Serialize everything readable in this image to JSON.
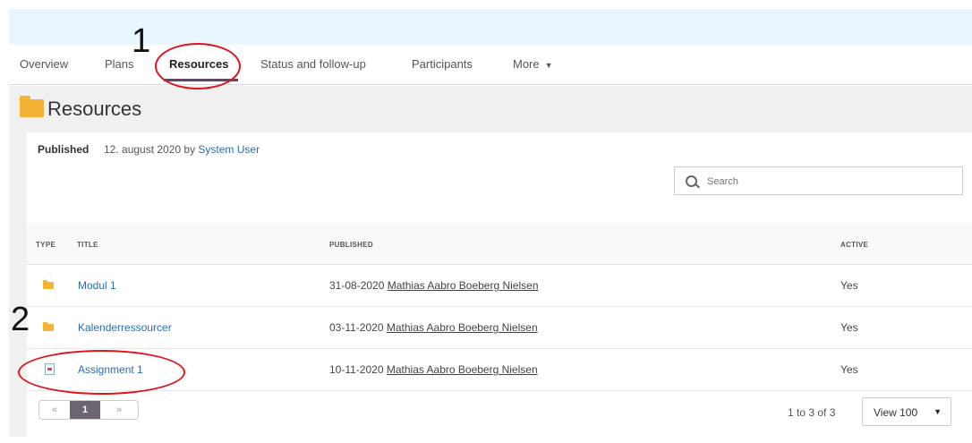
{
  "nav": {
    "tabs": [
      {
        "label": "Overview"
      },
      {
        "label": "Plans"
      },
      {
        "label": "Resources"
      },
      {
        "label": "Status and follow-up"
      },
      {
        "label": "Participants"
      },
      {
        "label": "More"
      }
    ]
  },
  "page": {
    "title": "Resources",
    "published_label": "Published",
    "published_date_text": "12. august 2020 by ",
    "published_by": "System User"
  },
  "search": {
    "placeholder": "Search",
    "value": ""
  },
  "table": {
    "headers": {
      "type": "TYPE",
      "title": "TITLE",
      "published": "PUBLISHED",
      "active": "ACTIVE"
    },
    "rows": [
      {
        "type_icon": "folder-icon",
        "title": "Modul 1",
        "date": "31-08-2020",
        "author": "Mathias Aabro Boeberg Nielsen",
        "active": "Yes"
      },
      {
        "type_icon": "folder-icon",
        "title": "Kalenderressourcer",
        "date": "03-11-2020",
        "author": "Mathias Aabro Boeberg Nielsen",
        "active": "Yes"
      },
      {
        "type_icon": "assignment-icon",
        "title": "Assignment 1",
        "date": "10-11-2020",
        "author": "Mathias Aabro Boeberg Nielsen",
        "active": "Yes"
      }
    ]
  },
  "pagination": {
    "prev": "«",
    "current": "1",
    "next": "»",
    "count": "1 to 3 of 3",
    "view": "View 100"
  },
  "annotations": {
    "n1": "1",
    "n2": "2"
  },
  "colors": {
    "accent": "#5a4a60",
    "link": "#2a6bb3",
    "folder": "#f5b335",
    "annotation": "#e0141c",
    "topbar": "#e8f6fd"
  }
}
